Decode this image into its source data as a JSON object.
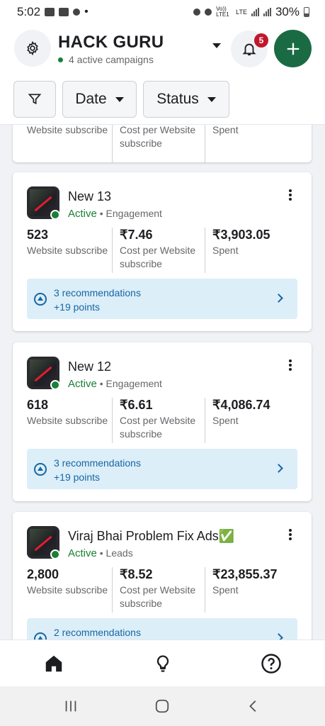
{
  "status_bar": {
    "time": "5:02",
    "dot": "•",
    "network": "Vo)) LTE1",
    "lte": "LTE",
    "battery": "30%"
  },
  "header": {
    "account_name": "HACK GURU",
    "subtitle": "4 active campaigns",
    "notification_count": "5",
    "icons": [
      "gear-icon",
      "bell-icon",
      "plus-icon",
      "chevron-down-icon"
    ]
  },
  "filters": {
    "date_label": "Date",
    "status_label": "Status"
  },
  "partial_card": {
    "labels": [
      "Website subscribe",
      "Cost per Website subscribe",
      "Spent"
    ]
  },
  "campaigns": [
    {
      "name": "New 13",
      "status": "Active",
      "objective": "Engagement",
      "metrics": [
        {
          "value": "523",
          "label": "Website subscribe"
        },
        {
          "value": "₹7.46",
          "label": "Cost per Website subscribe"
        },
        {
          "value": "₹3,903.05",
          "label": "Spent"
        }
      ],
      "recommendations": "3 recommendations",
      "points": "+19 points"
    },
    {
      "name": "New 12",
      "status": "Active",
      "objective": "Engagement",
      "metrics": [
        {
          "value": "618",
          "label": "Website subscribe"
        },
        {
          "value": "₹6.61",
          "label": "Cost per Website subscribe"
        },
        {
          "value": "₹4,086.74",
          "label": "Spent"
        }
      ],
      "recommendations": "3 recommendations",
      "points": "+19 points"
    },
    {
      "name": "Viraj Bhai Problem Fix Ads✅",
      "status": "Active",
      "objective": "Leads",
      "metrics": [
        {
          "value": "2,800",
          "label": "Website subscribe"
        },
        {
          "value": "₹8.52",
          "label": "Cost per Website subscribe"
        },
        {
          "value": "₹23,855.37",
          "label": "Spent"
        }
      ],
      "recommendations": "2 recommendations",
      "points": ""
    }
  ],
  "bottom_nav": {
    "icons": [
      "home-icon",
      "lightbulb-icon",
      "help-icon"
    ]
  },
  "colors": {
    "accent_green": "#1a6b43",
    "active_green": "#1a7f37",
    "badge_red": "#c0172d",
    "reco_bg": "#dceef8",
    "reco_text": "#1767a3"
  }
}
